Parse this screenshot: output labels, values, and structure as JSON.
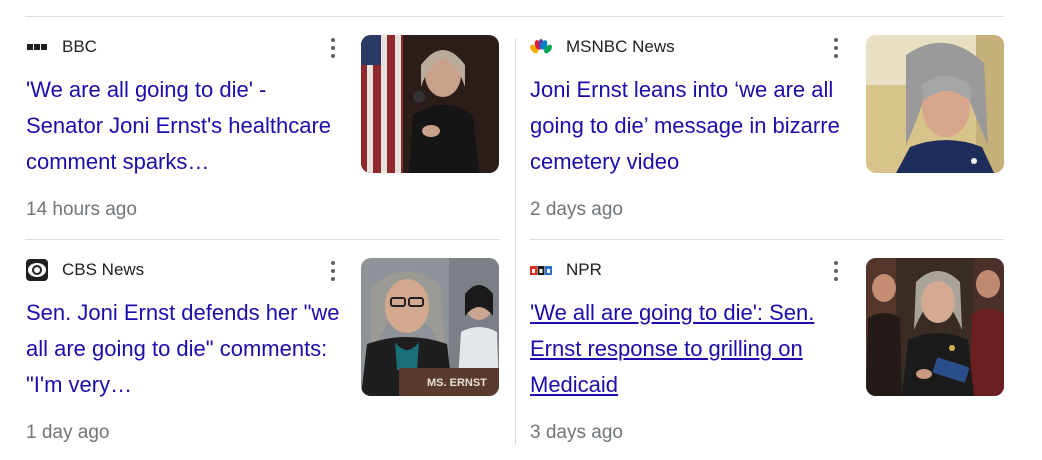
{
  "articles": [
    {
      "source": "BBC",
      "source_icon": "bbc-logo-icon",
      "headline": "'We are all going to die' - Senator Joni Ernst's healthcare comment sparks…",
      "time": "14 hours ago",
      "thumbnail": "photo-speaker-with-microphone-and-flag"
    },
    {
      "source": "MSNBC News",
      "source_icon": "msnbc-peacock-icon",
      "headline": "Joni Ernst leans into ‘we are all going to die’ message in bizarre cemetery video",
      "time": "2 days ago",
      "thumbnail": "photo-woman-gray-hair-closeup"
    },
    {
      "source": "CBS News",
      "source_icon": "cbs-eye-icon",
      "headline": "Sen. Joni Ernst defends her \"we all are going to die\" comments: \"I'm very…",
      "time": "1 day ago",
      "thumbnail": "photo-senator-at-hearing-nameplate",
      "thumbnail_text": "MS. ERNST"
    },
    {
      "source": "NPR",
      "source_icon": "npr-logo-icon",
      "headline": "'We all are going to die': Sen. Ernst response to grilling on Medicaid",
      "time": "3 days ago",
      "thumbnail": "photo-senator-surrounded-by-reporters"
    }
  ],
  "colors": {
    "headline": "#1a0dab",
    "source": "#202124",
    "timestamp": "#70757a",
    "divider": "#dadce0"
  }
}
